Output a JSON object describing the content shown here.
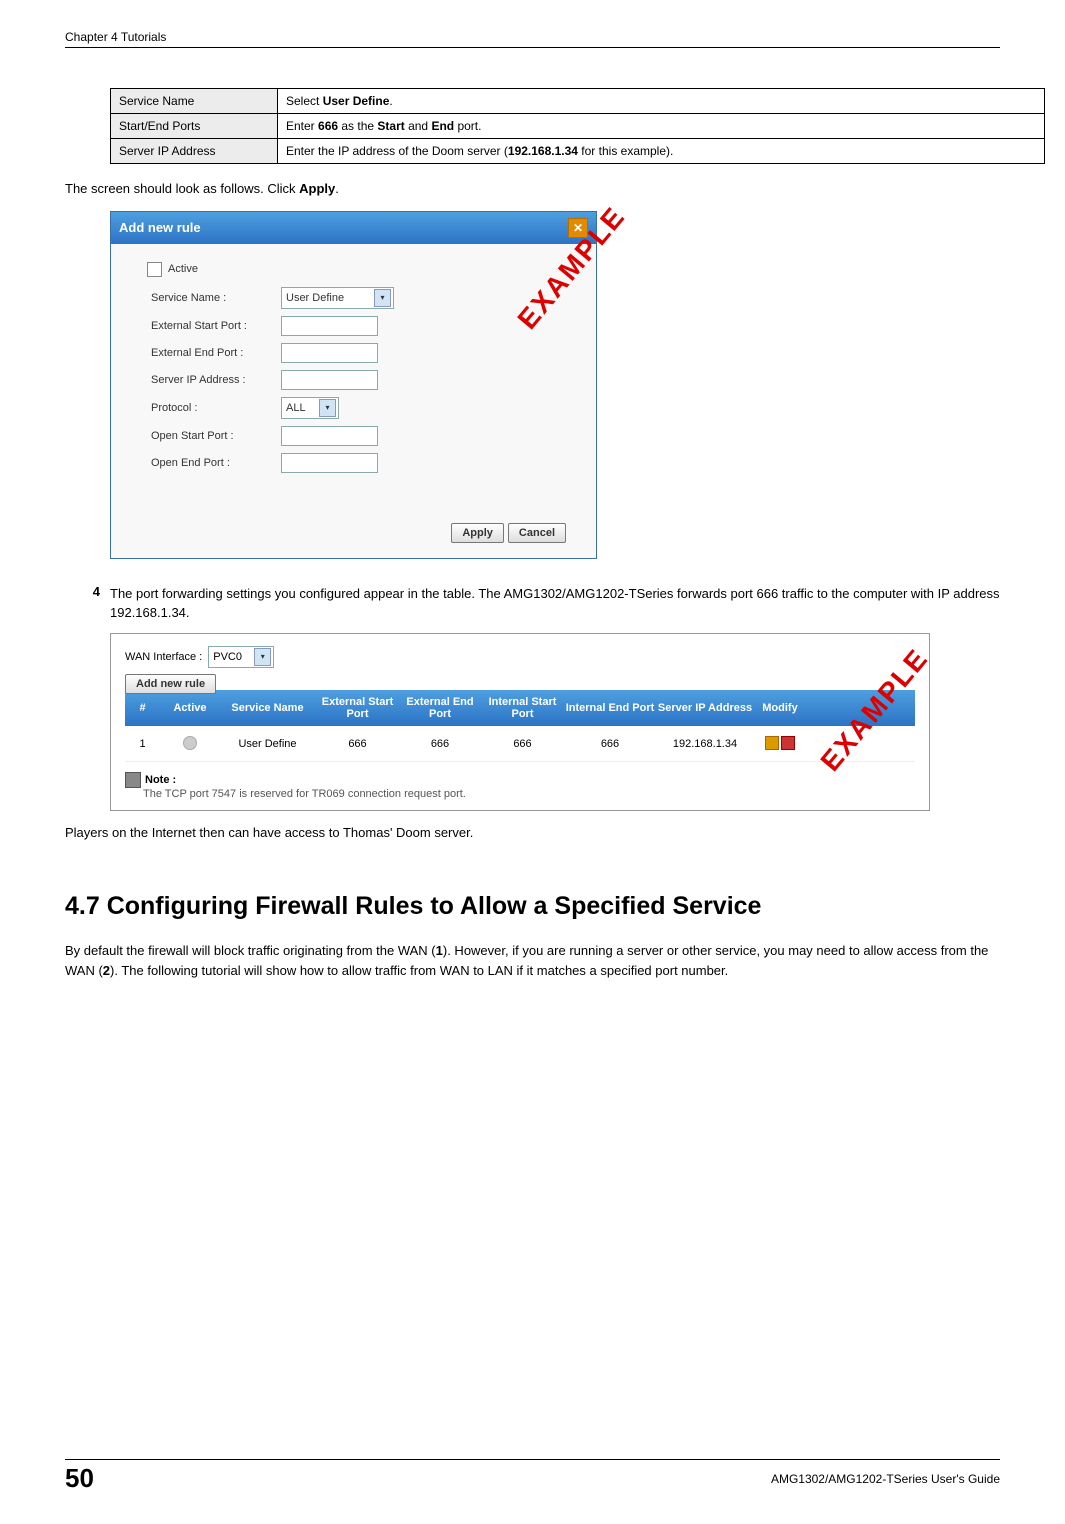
{
  "header": {
    "chapter": "Chapter 4 Tutorials"
  },
  "config_table": {
    "rows": [
      {
        "label": "Service Name",
        "prefix": "Select ",
        "bold": "User Define",
        "suffix": "."
      },
      {
        "label": "Start/End Ports",
        "prefix": "Enter ",
        "bold": "666",
        "mid": " as the ",
        "bold2": "Start",
        "mid2": " and ",
        "bold3": "End",
        "suffix": " port."
      },
      {
        "label": "Server IP Address",
        "prefix": "Enter the IP address of the Doom server (",
        "bold": "192.168.1.34",
        "suffix": " for this example)."
      }
    ]
  },
  "para1": {
    "prefix": "The screen should look as follows. Click ",
    "bold": "Apply",
    "suffix": "."
  },
  "dialog": {
    "title": "Add new rule",
    "active_label": "Active",
    "rows": {
      "service_name": {
        "label": "Service Name :",
        "value": "User Define"
      },
      "ext_start": {
        "label": "External Start Port :"
      },
      "ext_end": {
        "label": "External End Port :"
      },
      "server_ip": {
        "label": "Server IP Address :"
      },
      "protocol": {
        "label": "Protocol :",
        "value": "ALL"
      },
      "open_start": {
        "label": "Open Start Port :"
      },
      "open_end": {
        "label": "Open End Port :"
      }
    },
    "buttons": {
      "apply": "Apply",
      "cancel": "Cancel"
    }
  },
  "example_stamp": "EXAMPLE",
  "step4": {
    "num": "4",
    "text": "The port forwarding settings you configured appear in the table. The AMG1302/AMG1202-TSeries forwards port 666 traffic to the computer with IP address 192.168.1.34."
  },
  "result_panel": {
    "wan_label": "WAN Interface :",
    "wan_value": "PVC0",
    "add_button": "Add new rule",
    "headers": {
      "num": "#",
      "active": "Active",
      "name": "Service Name",
      "esp": "External Start Port",
      "eep": "External End Port",
      "isp": "Internal Start Port",
      "iep": "Internal End Port",
      "ip": "Server IP Address",
      "mod": "Modify"
    },
    "row": {
      "num": "1",
      "name": "User Define",
      "esp": "666",
      "eep": "666",
      "isp": "666",
      "iep": "666",
      "ip": "192.168.1.34"
    },
    "note_title": "Note :",
    "note_text": "The TCP port  7547 is reserved for TR069 connection request port."
  },
  "para2": "Players on the Internet then can have access to Thomas' Doom server.",
  "section": {
    "title": "4.7  Configuring Firewall Rules to Allow a Specified Service",
    "body_p1": "By default the firewall will block traffic originating from the WAN (",
    "bold1": "1",
    "body_mid": "). However, if you are running a server or other service, you may need to allow access from the WAN (",
    "bold2": "2",
    "body_suffix": "). The following tutorial will show how to allow traffic from WAN to LAN if it matches a specified port number."
  },
  "footer": {
    "page": "50",
    "guide": "AMG1302/AMG1202-TSeries User's Guide"
  },
  "chart_data": {
    "type": "table",
    "title": "Port Forwarding result",
    "columns": [
      "#",
      "Active",
      "Service Name",
      "External Start Port",
      "External End Port",
      "Internal Start Port",
      "Internal End Port",
      "Server IP Address"
    ],
    "rows": [
      [
        "1",
        "off",
        "User Define",
        "666",
        "666",
        "666",
        "666",
        "192.168.1.34"
      ]
    ]
  }
}
